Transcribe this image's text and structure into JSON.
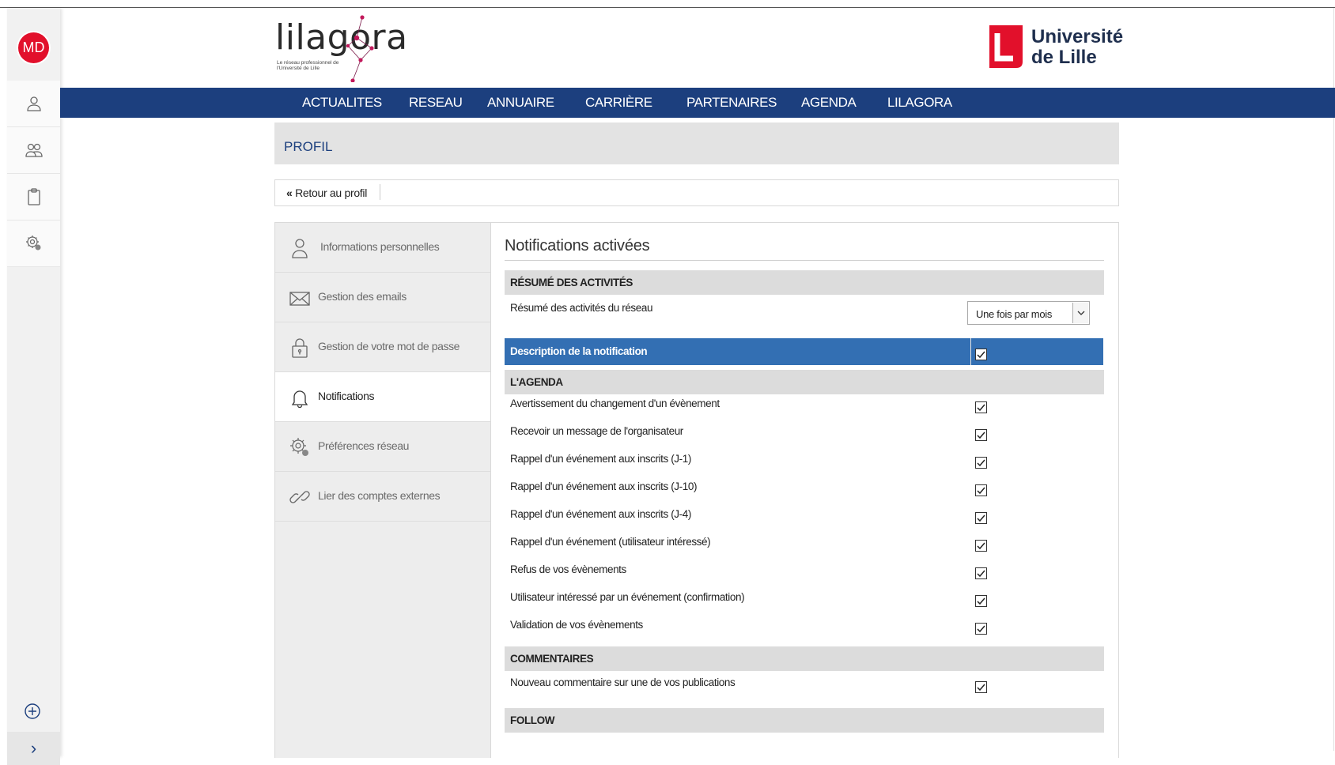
{
  "sidebar": {
    "avatar_initials": "MD",
    "items": [
      {
        "icon": "user-icon"
      },
      {
        "icon": "group-icon"
      },
      {
        "icon": "clipboard-icon"
      },
      {
        "icon": "settings-icon"
      }
    ],
    "add_icon": "plus-circle-icon",
    "toggle_label": "›"
  },
  "header": {
    "logo_text": "lilagora",
    "logo_subtitle": "Le réseau professionnel de l'Université de Lille",
    "university_line1": "Université",
    "university_line2": "de Lille",
    "university_brand_color": "#e2102b"
  },
  "nav": {
    "items": [
      "ACTUALITES",
      "RESEAU",
      "ANNUAIRE",
      "CARRIÈRE",
      "PARTENAIRES",
      "AGENDA",
      "LILAGORA"
    ],
    "bg_color": "#1c3f7e"
  },
  "page": {
    "title": "PROFIL",
    "back_label": "Retour au profil"
  },
  "menu": {
    "items": [
      {
        "label": "Informations personnelles",
        "icon": "user-icon",
        "active": false
      },
      {
        "label": "Gestion des emails",
        "icon": "envelope-icon",
        "active": false
      },
      {
        "label": "Gestion de votre mot de passe",
        "icon": "lock-icon",
        "active": false
      },
      {
        "label": "Notifications",
        "icon": "bell-icon",
        "active": true
      },
      {
        "label": "Préférences réseau",
        "icon": "settings-icon",
        "active": false
      },
      {
        "label": "Lier des comptes externes",
        "icon": "link-icon",
        "active": false
      }
    ]
  },
  "content": {
    "title": "Notifications activées",
    "resume": {
      "header": "RÉSUMÉ DES ACTIVITÉS",
      "row_label": "Résumé des activités du réseau",
      "select_value": "Une fois par mois"
    },
    "description_row": {
      "label": "Description de la notification",
      "checked": true,
      "highlight_color": "#336fb3"
    },
    "agenda": {
      "header": "L'AGENDA",
      "rows": [
        {
          "label": "Avertissement du changement d'un évènement",
          "checked": true
        },
        {
          "label": "Recevoir un message de l'organisateur",
          "checked": true
        },
        {
          "label": "Rappel d'un événement aux inscrits (J-1)",
          "checked": true
        },
        {
          "label": "Rappel d'un événement aux inscrits (J-10)",
          "checked": true
        },
        {
          "label": "Rappel d'un événement aux inscrits (J-4)",
          "checked": true
        },
        {
          "label": "Rappel d'un événement (utilisateur intéressé)",
          "checked": true
        },
        {
          "label": "Refus de vos évènements",
          "checked": true
        },
        {
          "label": "Utilisateur intéressé par un événement (confirmation)",
          "checked": true
        },
        {
          "label": "Validation de vos évènements",
          "checked": true
        }
      ]
    },
    "commentaires": {
      "header": "COMMENTAIRES",
      "rows": [
        {
          "label": "Nouveau commentaire sur une de vos publications",
          "checked": true
        }
      ]
    },
    "follow": {
      "header": "FOLLOW"
    }
  }
}
